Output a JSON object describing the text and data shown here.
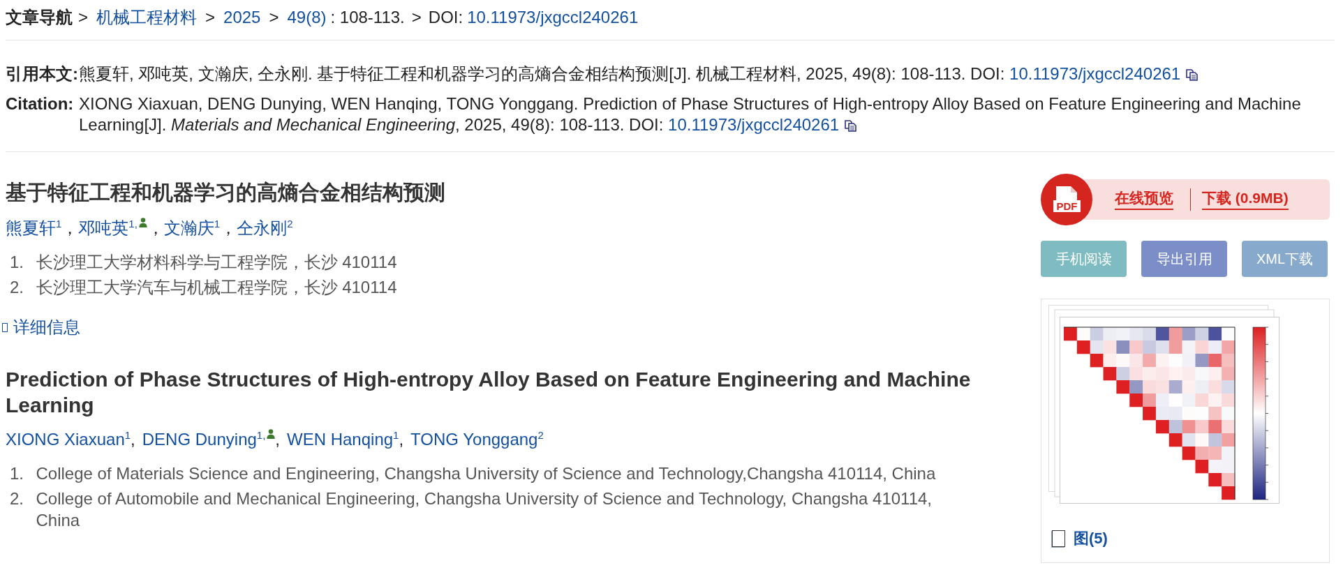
{
  "breadcrumb": {
    "label": "文章导航",
    "parts": [
      {
        "kind": "separator",
        "text": ">"
      },
      {
        "kind": "link",
        "text": "机械工程材料"
      },
      {
        "kind": "separator",
        "text": ">"
      },
      {
        "kind": "link",
        "text": "2025"
      },
      {
        "kind": "separator",
        "text": ">"
      },
      {
        "kind": "link",
        "text": "49(8)"
      },
      {
        "kind": "text",
        "text": ": 108-113."
      },
      {
        "kind": "separator",
        "text": ">"
      },
      {
        "kind": "text",
        "text": "DOI:"
      },
      {
        "kind": "link",
        "text": "10.11973/jxgccl240261"
      }
    ]
  },
  "citations": [
    {
      "label": "引用本文:",
      "text": "熊夏轩, 邓吨英, 文瀚庆, 仝永刚. 基于特征工程和机器学习的高熵合金相结构预测[J]. 机械工程材料, 2025, 49(8): 108-113. DOI:",
      "doi": "10.11973/jxgccl240261"
    },
    {
      "label": "Citation:",
      "text": "XIONG Xiaxuan, DENG Dunying, WEN Hanqing, TONG Yonggang. Prediction of Phase Structures of High-entropy Alloy Based on Feature Engineering and Machine Learning[J]. *Materials and Mechanical Engineering*, 2025, 49(8): 108-113. DOI:",
      "doi": "10.11973/jxgccl240261"
    }
  ],
  "article_zh": {
    "title": "基于特征工程和机器学习的高熵合金相结构预测",
    "separator": "，",
    "authors": [
      {
        "name": "熊夏轩",
        "sup": "1",
        "corresponding": false
      },
      {
        "name": "邓吨英",
        "sup": "1,",
        "corresponding": true
      },
      {
        "name": "文瀚庆",
        "sup": "1",
        "corresponding": false
      },
      {
        "name": "仝永刚",
        "sup": "2",
        "corresponding": false
      }
    ],
    "affiliations": [
      {
        "number": "1.",
        "text": "长沙理工大学材料科学与工程学院，长沙 410114"
      },
      {
        "number": "2.",
        "text": "长沙理工大学汽车与机械工程学院，长沙 410114"
      }
    ]
  },
  "details_link": {
    "label": "详细信息"
  },
  "article_en": {
    "title": "Prediction of Phase Structures of High-entropy Alloy Based on Feature Engineering and Machine Learning",
    "separator": ",",
    "authors": [
      {
        "name": "XIONG Xiaxuan",
        "sup": "1",
        "corresponding": false
      },
      {
        "name": "DENG Dunying",
        "sup": "1,",
        "corresponding": true
      },
      {
        "name": "WEN Hanqing",
        "sup": "1",
        "corresponding": false
      },
      {
        "name": "TONG Yonggang",
        "sup": "2",
        "corresponding": false
      }
    ],
    "affiliations": [
      {
        "number": "1.",
        "text": "College of Materials Science and Engineering, Changsha University of Science and Technology,Changsha 410114, China"
      },
      {
        "number": "2.",
        "text": "College of Automobile and Mechanical Engineering, Changsha University of Science and Technology, Changsha 410114, China"
      }
    ]
  },
  "pdf": {
    "icon_text": "PDF",
    "links": [
      "在线预览",
      "下载 (0.9MB)"
    ]
  },
  "actions": [
    {
      "label": "手机阅读",
      "color": "#7fbcc1"
    },
    {
      "label": "导出引用",
      "color": "#7b8ec8"
    },
    {
      "label": "XML下载",
      "color": "#87a9cc"
    }
  ],
  "figures": {
    "label": "图(5)"
  }
}
